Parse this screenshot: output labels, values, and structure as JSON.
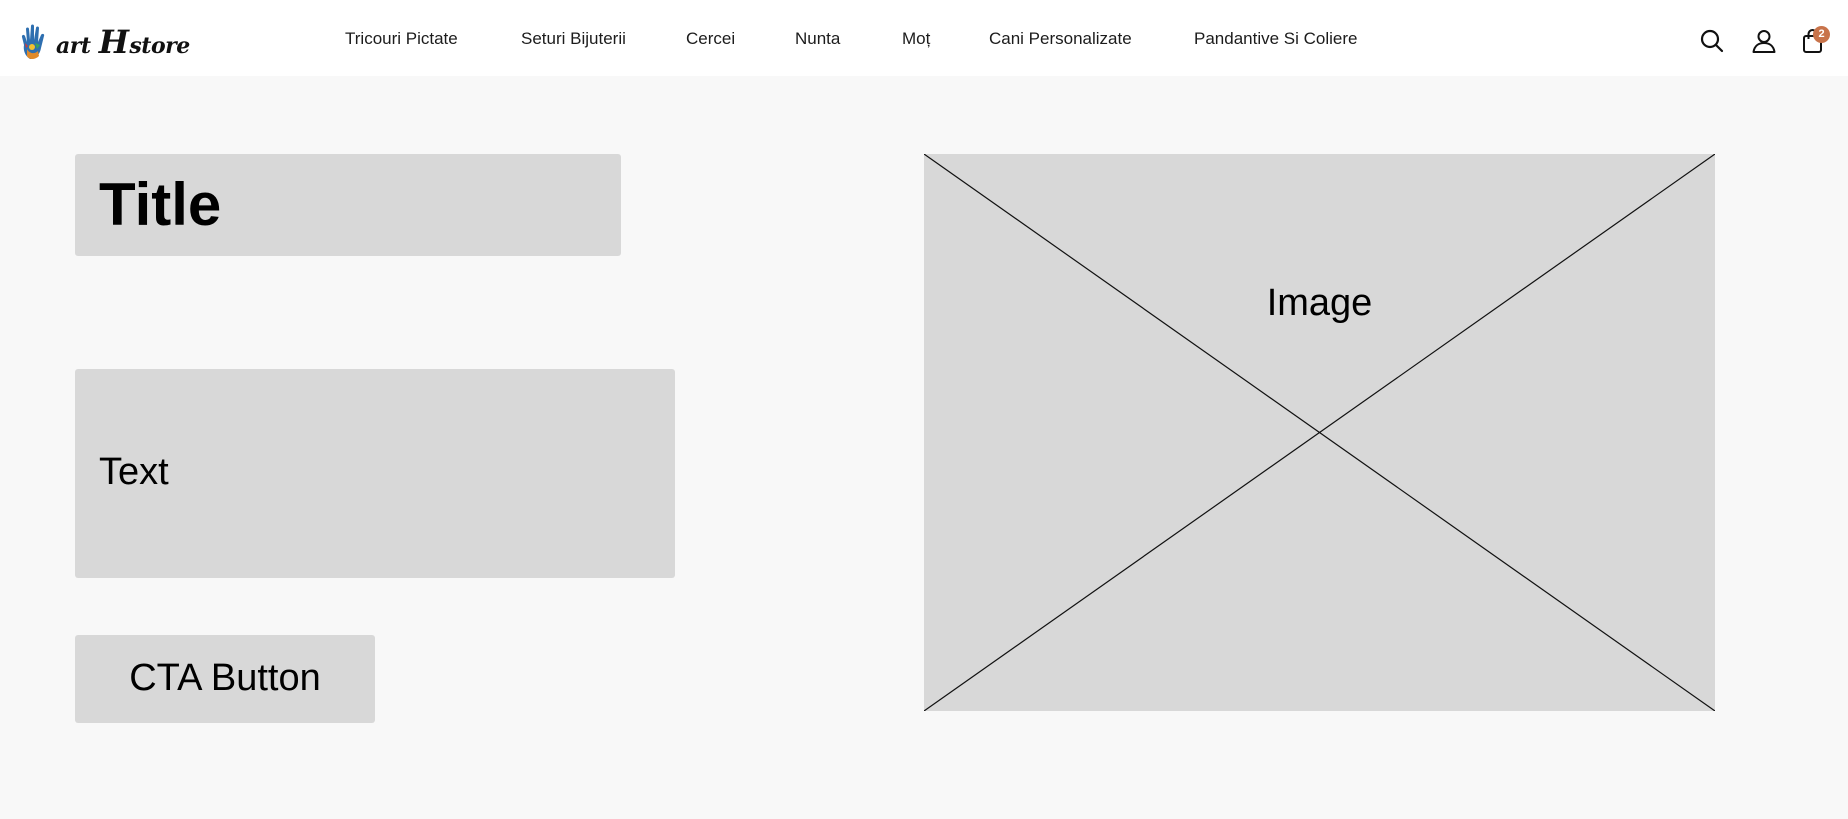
{
  "header": {
    "logo": {
      "text_a": "art",
      "text_h": "H",
      "text_b": "store"
    },
    "nav": [
      {
        "label": "Tricouri Pictate"
      },
      {
        "label": "Seturi Bijuterii"
      },
      {
        "label": "Cercei"
      },
      {
        "label": "Nunta"
      },
      {
        "label": "Moț"
      },
      {
        "label": "Cani Personalizate"
      },
      {
        "label": "Pandantive Si Coliere"
      }
    ],
    "icons": {
      "search": "search-icon",
      "account": "user-icon",
      "cart": "shopping-bag-icon"
    },
    "cart_count": "2",
    "badge_color": "#c8734a"
  },
  "main": {
    "title": "Title",
    "text": "Text",
    "cta_label": "CTA Button",
    "image_label": "Image"
  },
  "colors": {
    "page_background": "#f8f8f8",
    "header_background": "#ffffff",
    "placeholder": "#d8d8d8"
  }
}
